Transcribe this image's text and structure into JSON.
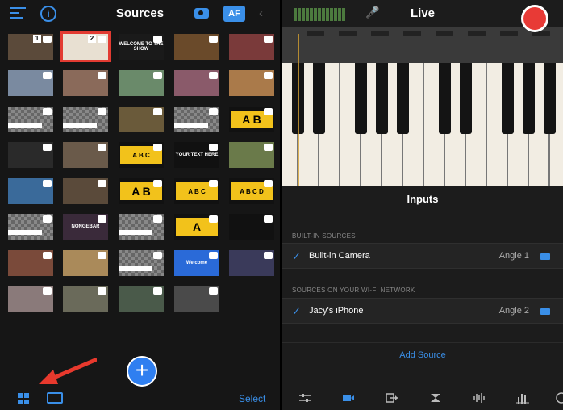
{
  "left_header": {
    "title": "Sources",
    "af_label": "AF"
  },
  "thumbnails": [
    {
      "row": 0,
      "col": 0,
      "number": "1",
      "type": "camera",
      "bg": "#5b4a3a"
    },
    {
      "row": 0,
      "col": 1,
      "number": "2",
      "type": "camera",
      "bg": "#e8e0d2",
      "selected": true
    },
    {
      "row": 0,
      "col": 2,
      "type": "text",
      "text": "WELCOME TO THE SHOW",
      "bg": "#1a1a1a"
    },
    {
      "row": 0,
      "col": 3,
      "type": "image",
      "bg": "#6a4a2a"
    },
    {
      "row": 0,
      "col": 4,
      "type": "image",
      "bg": "#7a3a3a"
    },
    {
      "row": 1,
      "col": 0,
      "type": "image",
      "bg": "#7a8aa0"
    },
    {
      "row": 1,
      "col": 1,
      "type": "image",
      "bg": "#8a6a5a"
    },
    {
      "row": 1,
      "col": 2,
      "type": "image",
      "bg": "#6a8a6a"
    },
    {
      "row": 1,
      "col": 3,
      "type": "image",
      "bg": "#8a5a6a"
    },
    {
      "row": 1,
      "col": 4,
      "type": "image",
      "bg": "#aa7a4a"
    },
    {
      "row": 2,
      "col": 0,
      "type": "overlay",
      "bg": "checker"
    },
    {
      "row": 2,
      "col": 1,
      "type": "overlay",
      "bg": "checker"
    },
    {
      "row": 2,
      "col": 2,
      "type": "image",
      "bg": "#6a5a3a"
    },
    {
      "row": 2,
      "col": 3,
      "type": "overlay",
      "bg": "checker"
    },
    {
      "row": 2,
      "col": 4,
      "type": "yellow",
      "text": "A B"
    },
    {
      "row": 3,
      "col": 0,
      "type": "image",
      "bg": "#2a2a2a"
    },
    {
      "row": 3,
      "col": 1,
      "type": "video",
      "bg": "#6a5a4a"
    },
    {
      "row": 3,
      "col": 2,
      "type": "yellow",
      "text": "A B C"
    },
    {
      "row": 3,
      "col": 3,
      "type": "text",
      "text": "YOUR TEXT HERE",
      "bg": "#111"
    },
    {
      "row": 3,
      "col": 4,
      "type": "image",
      "bg": "#6a7a4a"
    },
    {
      "row": 4,
      "col": 0,
      "type": "image",
      "bg": "#3a6a9a"
    },
    {
      "row": 4,
      "col": 1,
      "type": "video",
      "bg": "#5a4a3a"
    },
    {
      "row": 4,
      "col": 2,
      "type": "yellow",
      "text": "A B"
    },
    {
      "row": 4,
      "col": 3,
      "type": "yellow",
      "text": "A B C"
    },
    {
      "row": 4,
      "col": 4,
      "type": "yellow",
      "text": "A B C D"
    },
    {
      "row": 5,
      "col": 0,
      "type": "overlay",
      "bg": "checker"
    },
    {
      "row": 5,
      "col": 1,
      "type": "text",
      "text": "NONGEBAR",
      "bg": "#3a2a3a"
    },
    {
      "row": 5,
      "col": 2,
      "type": "overlay",
      "bg": "checker"
    },
    {
      "row": 5,
      "col": 3,
      "type": "yellow",
      "text": "A"
    },
    {
      "row": 5,
      "col": 4,
      "type": "video",
      "bg": "#111"
    },
    {
      "row": 6,
      "col": 0,
      "type": "image",
      "bg": "#7a4a3a"
    },
    {
      "row": 6,
      "col": 1,
      "type": "image",
      "bg": "#aa8a5a"
    },
    {
      "row": 6,
      "col": 2,
      "type": "overlay",
      "bg": "checker"
    },
    {
      "row": 6,
      "col": 3,
      "type": "text",
      "text": "Welcome",
      "bg": "#2a6ad8"
    },
    {
      "row": 6,
      "col": 4,
      "type": "image",
      "bg": "#3a3a5a"
    },
    {
      "row": 7,
      "col": 0,
      "type": "image",
      "bg": "#8a7a7a"
    },
    {
      "row": 7,
      "col": 1,
      "type": "video",
      "bg": "#6a6a5a"
    },
    {
      "row": 7,
      "col": 2,
      "type": "video",
      "bg": "#4a5a4a"
    },
    {
      "row": 7,
      "col": 3,
      "type": "video",
      "bg": "#4a4a4a"
    }
  ],
  "left_footer": {
    "select_label": "Select",
    "plus_label": "+"
  },
  "right_header": {
    "title": "Live"
  },
  "inputs": {
    "title": "Inputs",
    "builtin_heading": "BUILT-IN SOURCES",
    "builtin": [
      {
        "label": "Built-in Camera",
        "angle": "Angle 1",
        "checked": "✓"
      }
    ],
    "wifi_heading": "SOURCES ON YOUR WI-FI NETWORK",
    "wifi": [
      {
        "label": "Jacy's iPhone",
        "angle": "Angle 2",
        "checked": "✓"
      }
    ],
    "add_source": "Add Source"
  },
  "colors": {
    "accent": "#3a8fe8",
    "record": "#e83a36",
    "selected": "#e23b32",
    "annotation_arrow": "#e8392d"
  }
}
